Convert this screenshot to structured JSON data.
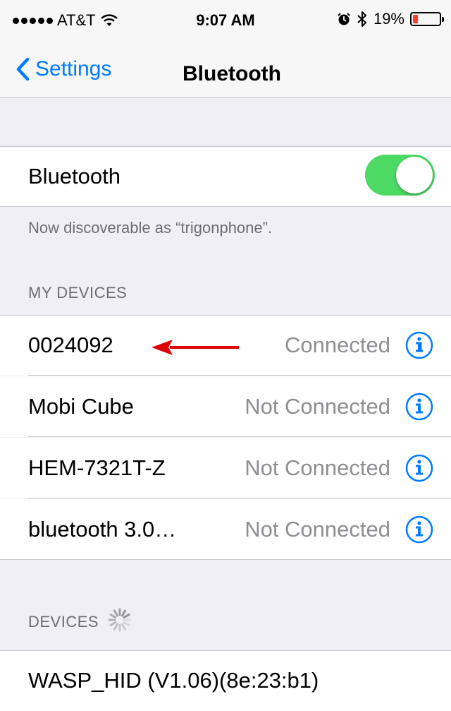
{
  "status_bar": {
    "carrier": "AT&T",
    "time": "9:07 AM",
    "battery": "19%",
    "battery_level": 0.19
  },
  "nav": {
    "back_label": "Settings",
    "title": "Bluetooth"
  },
  "bluetooth_toggle": {
    "label": "Bluetooth",
    "on": true
  },
  "discoverable_text": "Now discoverable as “trigonphone”.",
  "my_devices": {
    "header": "MY DEVICES",
    "items": [
      {
        "name": "0024092",
        "status": "Connected"
      },
      {
        "name": "Mobi Cube",
        "status": "Not Connected"
      },
      {
        "name": "HEM-7321T-Z",
        "status": "Not Connected"
      },
      {
        "name": "bluetooth 3.0…",
        "status": "Not Connected"
      }
    ]
  },
  "devices": {
    "header": "DEVICES",
    "items": [
      {
        "name": "WASP_HID (V1.06)(8e:23:b1)"
      }
    ]
  },
  "colors": {
    "accent": "#007aff",
    "toggle_on": "#4cd964",
    "annotation_arrow": "#e00000",
    "battery_low": "#ff3b30"
  },
  "icons": [
    "wifi-icon",
    "alarm-icon",
    "bluetooth-icon",
    "battery-icon",
    "chevron-left-icon",
    "info-icon",
    "arrow-left-icon",
    "spinner-icon"
  ]
}
